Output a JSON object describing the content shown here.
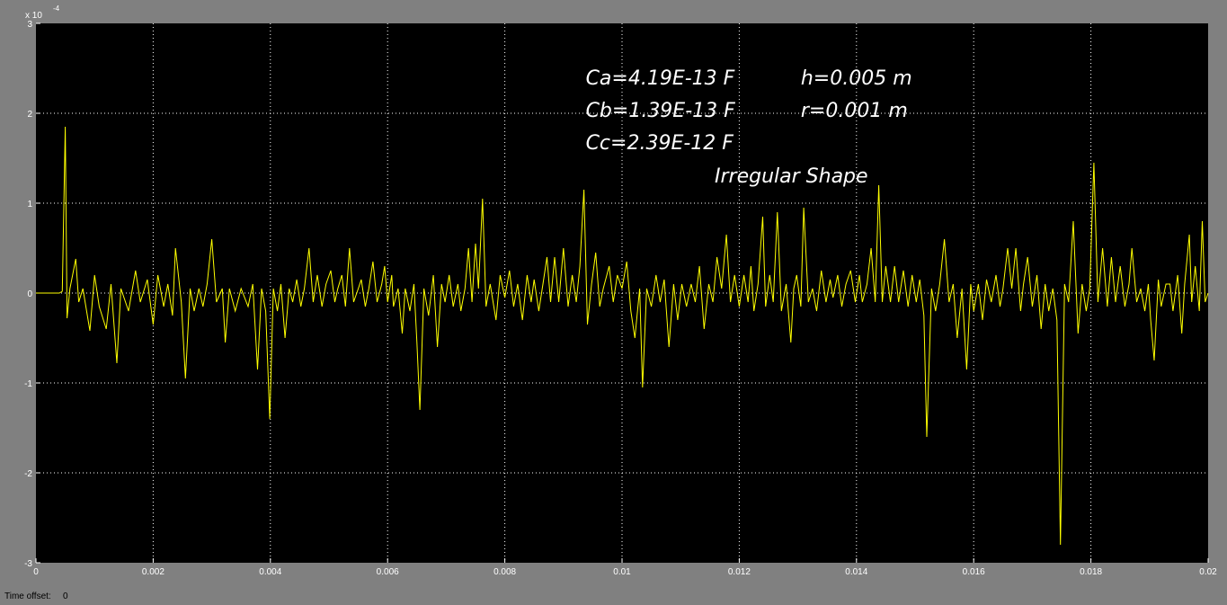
{
  "chart_data": {
    "type": "line",
    "x_ticks": [
      "0",
      "0.002",
      "0.004",
      "0.006",
      "0.008",
      "0.01",
      "0.012",
      "0.014",
      "0.016",
      "0.018",
      "0.02"
    ],
    "y_ticks": [
      "-3",
      "-2",
      "-1",
      "0",
      "1",
      "2",
      "3"
    ],
    "y_exponent": "x 10",
    "y_exponent_power": "-4",
    "xlim": [
      0,
      0.02
    ],
    "ylim": [
      -3,
      3
    ],
    "grid": true,
    "series": [
      {
        "color": "#ffff00",
        "points": [
          [
            0,
            0
          ],
          [
            0.0004,
            0
          ],
          [
            0.00045,
            0.02
          ],
          [
            0.0005,
            1.85
          ],
          [
            0.00053,
            -0.28
          ],
          [
            0.00058,
            0.05
          ],
          [
            0.00068,
            0.38
          ],
          [
            0.00073,
            -0.1
          ],
          [
            0.0008,
            0.05
          ],
          [
            0.00092,
            -0.42
          ],
          [
            0.001,
            0.2
          ],
          [
            0.00108,
            -0.15
          ],
          [
            0.0012,
            -0.4
          ],
          [
            0.00128,
            0.1
          ],
          [
            0.00138,
            -0.78
          ],
          [
            0.00145,
            0.05
          ],
          [
            0.00158,
            -0.2
          ],
          [
            0.0017,
            0.25
          ],
          [
            0.00178,
            -0.1
          ],
          [
            0.0019,
            0.15
          ],
          [
            0.002,
            -0.35
          ],
          [
            0.00208,
            0.2
          ],
          [
            0.00218,
            -0.15
          ],
          [
            0.00225,
            0.1
          ],
          [
            0.00233,
            -0.25
          ],
          [
            0.00238,
            0.5
          ],
          [
            0.00248,
            -0.1
          ],
          [
            0.00255,
            -0.95
          ],
          [
            0.00263,
            0.05
          ],
          [
            0.0027,
            -0.2
          ],
          [
            0.00278,
            0.05
          ],
          [
            0.00285,
            -0.15
          ],
          [
            0.00292,
            0.1
          ],
          [
            0.003,
            0.6
          ],
          [
            0.00308,
            -0.1
          ],
          [
            0.00318,
            0.05
          ],
          [
            0.00323,
            -0.55
          ],
          [
            0.0033,
            0.05
          ],
          [
            0.0034,
            -0.2
          ],
          [
            0.0035,
            0.05
          ],
          [
            0.00362,
            -0.15
          ],
          [
            0.0037,
            0.1
          ],
          [
            0.00378,
            -0.85
          ],
          [
            0.00385,
            0.05
          ],
          [
            0.00392,
            -0.2
          ],
          [
            0.00399,
            -1.4
          ],
          [
            0.00405,
            0.05
          ],
          [
            0.00412,
            -0.2
          ],
          [
            0.00418,
            0.1
          ],
          [
            0.00425,
            -0.5
          ],
          [
            0.00432,
            0.05
          ],
          [
            0.00438,
            -0.1
          ],
          [
            0.00445,
            0.15
          ],
          [
            0.00452,
            -0.15
          ],
          [
            0.00458,
            0.05
          ],
          [
            0.00466,
            0.5
          ],
          [
            0.00473,
            -0.1
          ],
          [
            0.0048,
            0.2
          ],
          [
            0.00488,
            -0.15
          ],
          [
            0.00495,
            0.1
          ],
          [
            0.00503,
            0.25
          ],
          [
            0.0051,
            -0.1
          ],
          [
            0.00515,
            0.05
          ],
          [
            0.00522,
            0.2
          ],
          [
            0.00528,
            -0.15
          ],
          [
            0.00535,
            0.5
          ],
          [
            0.00542,
            -0.1
          ],
          [
            0.0055,
            0.05
          ],
          [
            0.00555,
            0.15
          ],
          [
            0.00562,
            -0.15
          ],
          [
            0.00568,
            0.05
          ],
          [
            0.00575,
            0.35
          ],
          [
            0.00582,
            -0.1
          ],
          [
            0.0059,
            0.1
          ],
          [
            0.00595,
            0.3
          ],
          [
            0.006,
            -0.1
          ],
          [
            0.00607,
            0.2
          ],
          [
            0.0061,
            -0.15
          ],
          [
            0.00618,
            0.05
          ],
          [
            0.00625,
            -0.45
          ],
          [
            0.0063,
            0.05
          ],
          [
            0.00638,
            -0.2
          ],
          [
            0.00645,
            0.1
          ],
          [
            0.0065,
            -0.55
          ],
          [
            0.00655,
            -1.3
          ],
          [
            0.00662,
            0.05
          ],
          [
            0.0067,
            -0.25
          ],
          [
            0.00678,
            0.2
          ],
          [
            0.00685,
            -0.6
          ],
          [
            0.00692,
            0.1
          ],
          [
            0.00698,
            -0.1
          ],
          [
            0.00705,
            0.2
          ],
          [
            0.00712,
            -0.15
          ],
          [
            0.0072,
            0.1
          ],
          [
            0.00725,
            -0.2
          ],
          [
            0.00732,
            0.05
          ],
          [
            0.00738,
            0.5
          ],
          [
            0.00744,
            -0.1
          ],
          [
            0.0075,
            0.55
          ],
          [
            0.00755,
            0.05
          ],
          [
            0.00762,
            1.05
          ],
          [
            0.00768,
            -0.15
          ],
          [
            0.00775,
            0.1
          ],
          [
            0.00785,
            -0.3
          ],
          [
            0.00792,
            0.2
          ],
          [
            0.008,
            -0.05
          ],
          [
            0.00808,
            0.25
          ],
          [
            0.00815,
            -0.15
          ],
          [
            0.00822,
            0.1
          ],
          [
            0.0083,
            -0.3
          ],
          [
            0.00838,
            0.2
          ],
          [
            0.00845,
            -0.1
          ],
          [
            0.0085,
            0.15
          ],
          [
            0.00858,
            -0.2
          ],
          [
            0.00865,
            0.1
          ],
          [
            0.00872,
            0.4
          ],
          [
            0.00878,
            -0.1
          ],
          [
            0.00885,
            0.4
          ],
          [
            0.00892,
            -0.1
          ],
          [
            0.009,
            0.5
          ],
          [
            0.00908,
            -0.15
          ],
          [
            0.00915,
            0.2
          ],
          [
            0.00922,
            -0.1
          ],
          [
            0.00928,
            0.3
          ],
          [
            0.00935,
            1.15
          ],
          [
            0.00941,
            -0.35
          ],
          [
            0.00948,
            0.1
          ],
          [
            0.00955,
            0.45
          ],
          [
            0.00962,
            -0.15
          ],
          [
            0.00968,
            0.05
          ],
          [
            0.00978,
            0.3
          ],
          [
            0.00985,
            -0.1
          ],
          [
            0.00992,
            0.2
          ],
          [
            0.01,
            0.05
          ],
          [
            0.01008,
            0.35
          ],
          [
            0.01015,
            -0.2
          ],
          [
            0.01022,
            -0.5
          ],
          [
            0.0103,
            0.05
          ],
          [
            0.01035,
            -1.05
          ],
          [
            0.01042,
            0.05
          ],
          [
            0.0105,
            -0.15
          ],
          [
            0.01058,
            0.2
          ],
          [
            0.01065,
            -0.1
          ],
          [
            0.01072,
            0.15
          ],
          [
            0.0108,
            -0.6
          ],
          [
            0.01088,
            0.1
          ],
          [
            0.01095,
            -0.3
          ],
          [
            0.01102,
            0.1
          ],
          [
            0.0111,
            -0.15
          ],
          [
            0.01118,
            0.1
          ],
          [
            0.01125,
            -0.1
          ],
          [
            0.01132,
            0.3
          ],
          [
            0.0114,
            -0.4
          ],
          [
            0.01148,
            0.1
          ],
          [
            0.01155,
            -0.1
          ],
          [
            0.01162,
            0.4
          ],
          [
            0.0117,
            0.05
          ],
          [
            0.01178,
            0.65
          ],
          [
            0.01185,
            -0.1
          ],
          [
            0.01192,
            0.2
          ],
          [
            0.012,
            -0.15
          ],
          [
            0.01208,
            0.2
          ],
          [
            0.01215,
            -0.1
          ],
          [
            0.0122,
            0.3
          ],
          [
            0.01225,
            -0.2
          ],
          [
            0.01232,
            0.1
          ],
          [
            0.0124,
            0.85
          ],
          [
            0.01245,
            -0.15
          ],
          [
            0.01252,
            0.2
          ],
          [
            0.01258,
            -0.1
          ],
          [
            0.01265,
            0.9
          ],
          [
            0.01272,
            -0.2
          ],
          [
            0.0128,
            0.1
          ],
          [
            0.01288,
            -0.55
          ],
          [
            0.01293,
            0.05
          ],
          [
            0.01298,
            0.2
          ],
          [
            0.01305,
            -0.15
          ],
          [
            0.0131,
            0.95
          ],
          [
            0.01318,
            -0.1
          ],
          [
            0.01325,
            0.05
          ],
          [
            0.01332,
            -0.2
          ],
          [
            0.0134,
            0.25
          ],
          [
            0.01348,
            -0.1
          ],
          [
            0.01355,
            0.15
          ],
          [
            0.0136,
            -0.05
          ],
          [
            0.01368,
            0.2
          ],
          [
            0.01375,
            -0.15
          ],
          [
            0.01382,
            0.1
          ],
          [
            0.0139,
            0.25
          ],
          [
            0.01398,
            -0.1
          ],
          [
            0.01405,
            0.2
          ],
          [
            0.0141,
            -0.1
          ],
          [
            0.01418,
            0.1
          ],
          [
            0.01425,
            0.5
          ],
          [
            0.01432,
            -0.1
          ],
          [
            0.01438,
            1.2
          ],
          [
            0.01444,
            -0.1
          ],
          [
            0.0145,
            0.3
          ],
          [
            0.01458,
            -0.1
          ],
          [
            0.01465,
            0.3
          ],
          [
            0.01472,
            -0.1
          ],
          [
            0.0148,
            0.25
          ],
          [
            0.01488,
            -0.15
          ],
          [
            0.01495,
            0.2
          ],
          [
            0.01502,
            -0.1
          ],
          [
            0.01508,
            0.15
          ],
          [
            0.01515,
            -0.25
          ],
          [
            0.0152,
            -1.6
          ],
          [
            0.01528,
            0.05
          ],
          [
            0.01535,
            -0.2
          ],
          [
            0.01542,
            0.1
          ],
          [
            0.0155,
            0.6
          ],
          [
            0.01558,
            -0.1
          ],
          [
            0.01565,
            0.1
          ],
          [
            0.01572,
            -0.5
          ],
          [
            0.0158,
            0.05
          ],
          [
            0.01588,
            -0.85
          ],
          [
            0.01595,
            0.1
          ],
          [
            0.016,
            -0.2
          ],
          [
            0.01608,
            0.1
          ],
          [
            0.01615,
            -0.3
          ],
          [
            0.01622,
            0.15
          ],
          [
            0.0163,
            -0.1
          ],
          [
            0.01638,
            0.2
          ],
          [
            0.01645,
            -0.15
          ],
          [
            0.0165,
            0.05
          ],
          [
            0.01658,
            0.5
          ],
          [
            0.01665,
            0.05
          ],
          [
            0.01672,
            0.5
          ],
          [
            0.0168,
            -0.2
          ],
          [
            0.01685,
            0.1
          ],
          [
            0.01692,
            0.4
          ],
          [
            0.017,
            -0.15
          ],
          [
            0.01708,
            0.2
          ],
          [
            0.01715,
            -0.4
          ],
          [
            0.01722,
            0.1
          ],
          [
            0.01728,
            -0.2
          ],
          [
            0.01735,
            0.05
          ],
          [
            0.01742,
            -0.3
          ],
          [
            0.01748,
            -2.8
          ],
          [
            0.01755,
            0.1
          ],
          [
            0.01762,
            -0.1
          ],
          [
            0.0177,
            0.8
          ],
          [
            0.01778,
            -0.45
          ],
          [
            0.01785,
            0.1
          ],
          [
            0.01792,
            -0.2
          ],
          [
            0.01798,
            0.05
          ],
          [
            0.01805,
            1.45
          ],
          [
            0.01812,
            -0.1
          ],
          [
            0.0182,
            0.5
          ],
          [
            0.01828,
            -0.15
          ],
          [
            0.01835,
            0.4
          ],
          [
            0.01842,
            -0.1
          ],
          [
            0.0185,
            0.3
          ],
          [
            0.01858,
            -0.15
          ],
          [
            0.01865,
            0.1
          ],
          [
            0.0187,
            0.5
          ],
          [
            0.01878,
            -0.1
          ],
          [
            0.01885,
            0.05
          ],
          [
            0.01892,
            -0.2
          ],
          [
            0.01898,
            0.1
          ],
          [
            0.01902,
            -0.3
          ],
          [
            0.01908,
            -0.75
          ],
          [
            0.01915,
            0.15
          ],
          [
            0.0192,
            -0.15
          ],
          [
            0.01928,
            0.1
          ],
          [
            0.01935,
            0.1
          ],
          [
            0.0194,
            -0.2
          ],
          [
            0.01948,
            0.2
          ],
          [
            0.01955,
            -0.45
          ],
          [
            0.0196,
            0.1
          ],
          [
            0.01968,
            0.65
          ],
          [
            0.01972,
            -0.1
          ],
          [
            0.01978,
            0.3
          ],
          [
            0.01985,
            -0.2
          ],
          [
            0.0199,
            0.8
          ],
          [
            0.01995,
            -0.1
          ],
          [
            0.02,
            0
          ]
        ]
      }
    ],
    "annotations": [
      {
        "id": "ca",
        "text": "Ca=4.19E-13 F",
        "x": 0.00938,
        "y": 2.32
      },
      {
        "id": "h",
        "text": "h=0.005 m",
        "x": 0.01305,
        "y": 2.32
      },
      {
        "id": "cb",
        "text": "Cb=1.39E-13 F",
        "x": 0.00938,
        "y": 1.96
      },
      {
        "id": "r",
        "text": "r=0.001 m",
        "x": 0.01305,
        "y": 1.96
      },
      {
        "id": "cc",
        "text": "Cc=2.39E-12 F",
        "x": 0.00938,
        "y": 1.6
      },
      {
        "id": "shape",
        "text": "Irregular Shape",
        "x": 0.01158,
        "y": 1.23
      }
    ]
  },
  "status": {
    "time_offset_label": "Time offset:",
    "time_offset_value": "0"
  }
}
